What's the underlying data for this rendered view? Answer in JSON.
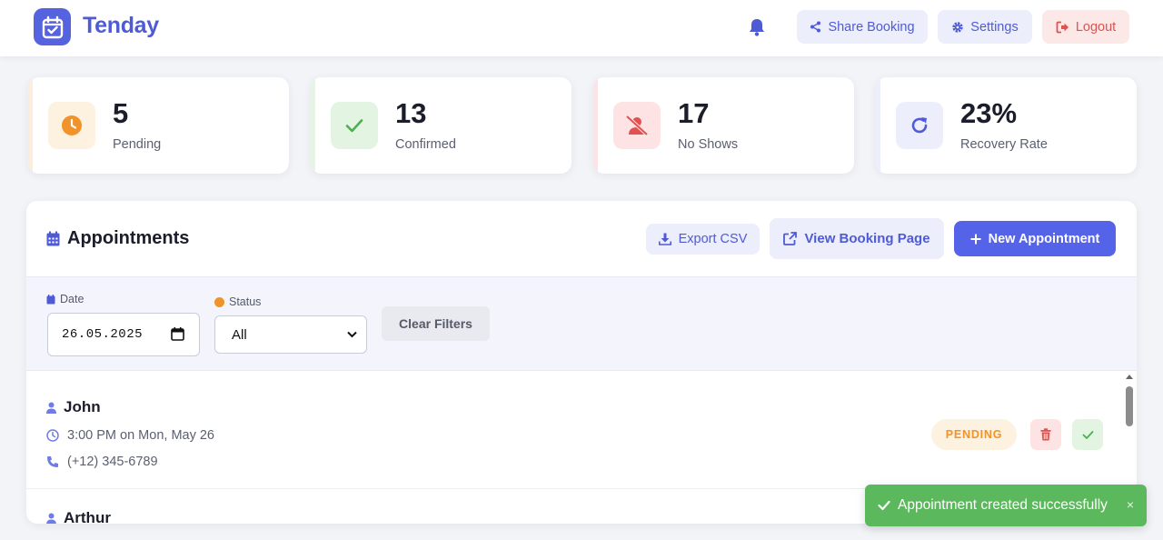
{
  "app": {
    "brand": "Tenday"
  },
  "header": {
    "share_label": "Share Booking",
    "settings_label": "Settings",
    "logout_label": "Logout"
  },
  "stats": [
    {
      "value": "5",
      "label": "Pending",
      "icon": "clock-icon",
      "color": "#f0932b",
      "bg": "#fdf1e0"
    },
    {
      "value": "13",
      "label": "Confirmed",
      "icon": "check-icon",
      "color": "#4caf50",
      "bg": "#e3f4e3"
    },
    {
      "value": "17",
      "label": "No Shows",
      "icon": "user-slash-icon",
      "color": "#e0524f",
      "bg": "#fde3e3"
    },
    {
      "value": "23%",
      "label": "Recovery Rate",
      "icon": "redo-icon",
      "color": "#4f5bd5",
      "bg": "#eceefb"
    }
  ],
  "appointments": {
    "title": "Appointments",
    "export_label": "Export CSV",
    "view_label": "View Booking Page",
    "new_label": "New Appointment"
  },
  "filters": {
    "date_label": "Date",
    "date_value": "26.05.2025",
    "status_label": "Status",
    "status_value": "All",
    "clear_label": "Clear Filters"
  },
  "list": [
    {
      "name": "John",
      "time": "3:00 PM on Mon, May 26",
      "phone": "(+12) 345-6789",
      "status": "PENDING"
    },
    {
      "name": "Arthur"
    }
  ],
  "toast": {
    "message": "Appointment created successfully",
    "close": "×"
  },
  "colors": {
    "accent": "#5563e8",
    "brand": "#4f5bd5",
    "success": "#5cb85c",
    "danger": "#e0524f",
    "warning": "#f0932b"
  }
}
